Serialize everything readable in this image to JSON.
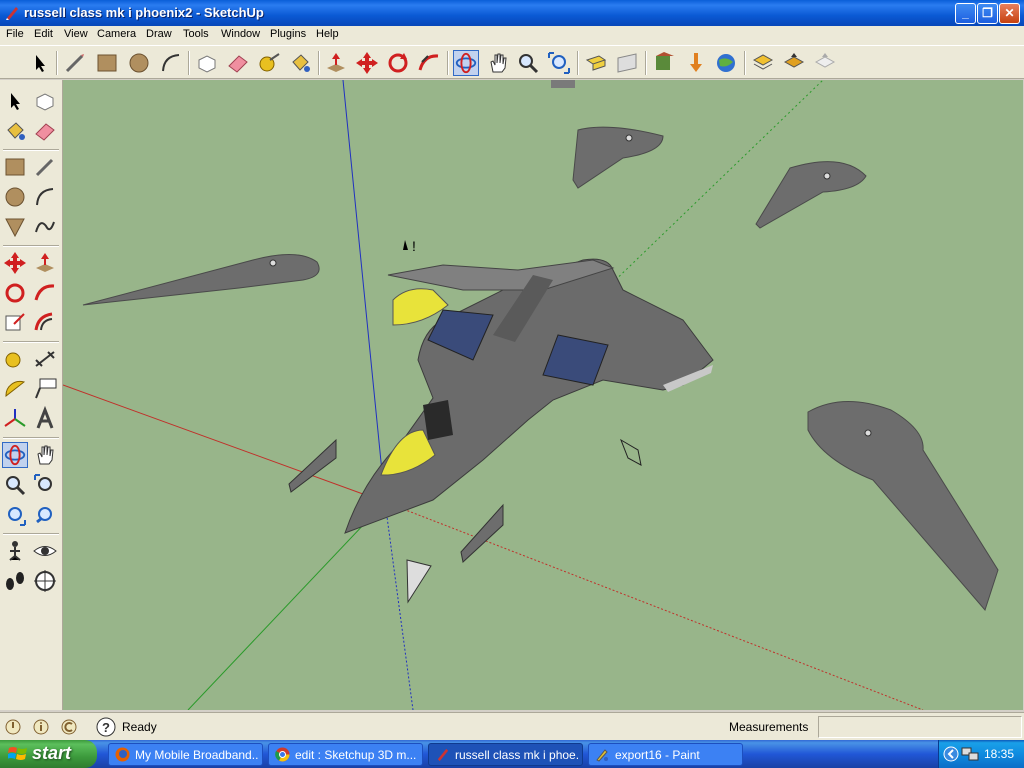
{
  "window": {
    "title": "russell class mk i phoenix2 - SketchUp",
    "controls": {
      "minimize": "_",
      "maximize": "❐",
      "close": "✕"
    }
  },
  "menu": [
    "File",
    "Edit",
    "View",
    "Camera",
    "Draw",
    "Tools",
    "Window",
    "Plugins",
    "Help"
  ],
  "toolbar_icons": [
    "select-icon",
    "line-icon",
    "rectangle-icon",
    "circle-icon",
    "arc-icon",
    "make-component-icon",
    "eraser-icon",
    "tape-measure-icon",
    "paint-bucket-icon",
    "push-pull-icon",
    "move-icon",
    "rotate-icon",
    "follow-me-icon",
    "orbit-icon",
    "pan-icon",
    "zoom-icon",
    "zoom-extents-icon",
    "previous-view-icon",
    "next-view-icon",
    "get-models-icon",
    "share-model-icon",
    "google-earth-icon",
    "get-current-view-icon",
    "toggle-terrain-icon",
    "place-model-icon"
  ],
  "left_tool_icons": [
    "select-icon",
    "make-component-icon",
    "paint-bucket-icon",
    "eraser-icon",
    "rectangle-icon",
    "line-icon",
    "circle-icon",
    "arc-icon",
    "polygon-icon",
    "freehand-icon",
    "move-icon",
    "push-pull-icon",
    "rotate-icon",
    "follow-me-icon",
    "scale-icon",
    "offset-icon",
    "tape-measure-icon",
    "dimension-icon",
    "protractor-icon",
    "text-icon",
    "axes-icon",
    "3d-text-icon",
    "orbit-icon",
    "pan-icon",
    "zoom-icon",
    "zoom-window-icon",
    "zoom-extents-icon",
    "previous-icon",
    "position-camera-icon",
    "look-around-icon",
    "walk-icon",
    "section-plane-icon"
  ],
  "statusbar": {
    "status": "Ready",
    "measurements_label": "Measurements",
    "measurements_value": ""
  },
  "taskbar": {
    "start_label": "start",
    "tasks": [
      "My Mobile Broadband...",
      "edit : Sketchup 3D m...",
      "russell class mk i phoe...",
      "export16 - Paint"
    ],
    "clock": "18:35"
  },
  "colors": {
    "viewport_bg": "#98b58a",
    "model_grey": "#6f6f6f",
    "cockpit_yellow": "#e8e33a",
    "axis_red": "#c0302a",
    "axis_green": "#2a9a2a",
    "axis_blue": "#2030c0"
  }
}
